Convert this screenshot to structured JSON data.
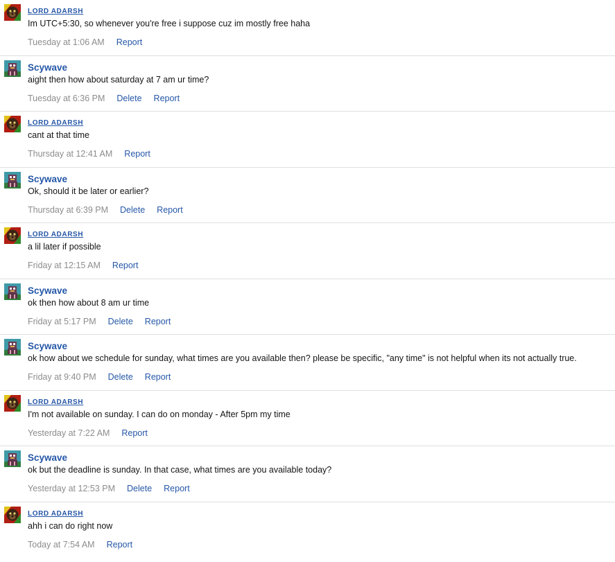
{
  "actions": {
    "report": "Report",
    "delete": "Delete"
  },
  "colors": {
    "link": "#2557a7",
    "time": "#8c8c8c",
    "divider": "#dfdfdf"
  },
  "users": {
    "adarsh": {
      "name": "LORD ADARSH",
      "avatar_icon": "dog-avatar-icon"
    },
    "scywave": {
      "name": "Scywave",
      "avatar_icon": "robot-avatar-icon"
    }
  },
  "messages": [
    {
      "author": "LORD ADARSH",
      "text": "Im UTC+5:30, so whenever you're free i suppose cuz im mostly free haha",
      "time": "Tuesday at 1:06 AM"
    },
    {
      "author": "Scywave",
      "text": "aight then how about saturday at 7 am ur time?",
      "time": "Tuesday at 6:36 PM"
    },
    {
      "author": "LORD ADARSH",
      "text": "cant at that time",
      "time": "Thursday at 12:41 AM"
    },
    {
      "author": "Scywave",
      "text": "Ok, should it be later or earlier?",
      "time": "Thursday at 6:39 PM"
    },
    {
      "author": "LORD ADARSH",
      "text": "a lil later if possible",
      "time": "Friday at 12:15 AM"
    },
    {
      "author": "Scywave",
      "text": "ok then how about 8 am ur time",
      "time": "Friday at 5:17 PM"
    },
    {
      "author": "Scywave",
      "text": "ok how about we schedule for sunday, what times are you available then? please be specific, \"any time\" is not helpful when its not actually true.",
      "time": "Friday at 9:40 PM"
    },
    {
      "author": "LORD ADARSH",
      "text": "I'm not available on sunday. I can do on monday - After 5pm my time",
      "time": "Yesterday at 7:22 AM"
    },
    {
      "author": "Scywave",
      "text": "ok but the deadline is sunday. In that case, what times are you available today?",
      "time": "Yesterday at 12:53 PM"
    },
    {
      "author": "LORD ADARSH",
      "text": "ahh i can do right now",
      "time": "Today at 7:54 AM"
    }
  ]
}
